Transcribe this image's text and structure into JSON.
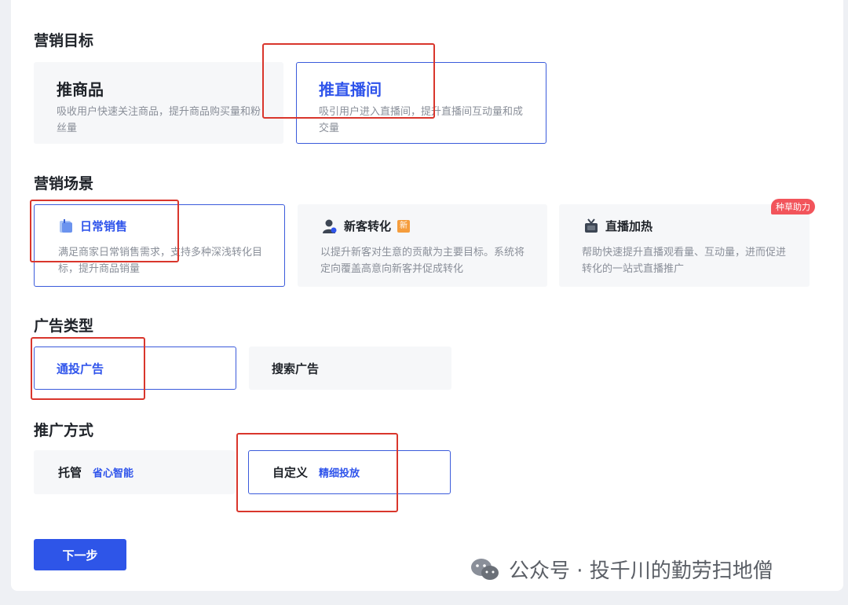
{
  "sections": {
    "goal": "营销目标",
    "scene": "营销场景",
    "ad_type": "广告类型",
    "method": "推广方式"
  },
  "goals": [
    {
      "title": "推商品",
      "desc": "吸收用户快速关注商品，提升商品购买量和粉丝量"
    },
    {
      "title": "推直播间",
      "desc": "吸引用户进入直播间，提升直播间互动量和成交量"
    }
  ],
  "scenes": [
    {
      "title": "日常销售",
      "icon": "calendar-icon",
      "desc": "满足商家日常销售需求，支持多种深浅转化目标，提升商品销量"
    },
    {
      "title": "新客转化",
      "icon": "user-icon",
      "tag": "新",
      "desc": "以提升新客对生意的贡献为主要目标。系统将定向覆盖高意向新客并促成转化"
    },
    {
      "title": "直播加热",
      "icon": "tv-icon",
      "badge": "种草助力",
      "desc": "帮助快速提升直播观看量、互动量，进而促进转化的一站式直播推广"
    }
  ],
  "ad_types": [
    "通投广告",
    "搜索广告"
  ],
  "methods": [
    {
      "name": "托管",
      "sub": "省心智能"
    },
    {
      "name": "自定义",
      "sub": "精细投放"
    }
  ],
  "next_label": "下一步",
  "watermark": "公众号 · 投千川的勤劳扫地僧",
  "colors": {
    "accent": "#2f54eb",
    "highlight": "#d9362c",
    "badge": "#f2545b"
  }
}
